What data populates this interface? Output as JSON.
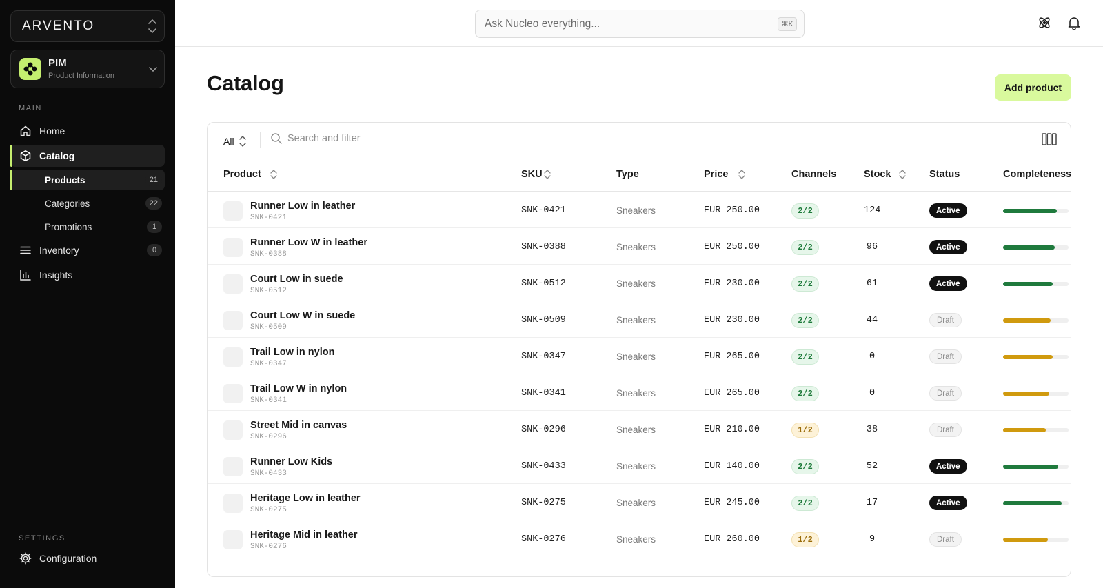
{
  "sidebar": {
    "org_name": "ARVENTO",
    "app": {
      "title": "PIM",
      "subtitle": "Product Information"
    },
    "main_label": "MAIN",
    "settings_label": "SETTINGS",
    "nav": {
      "home": "Home",
      "catalog": "Catalog",
      "inventory": "Inventory",
      "inventory_count": "0",
      "insights": "Insights",
      "configuration": "Configuration"
    },
    "catalog_children": [
      {
        "label": "Products",
        "count": "21"
      },
      {
        "label": "Categories",
        "count": "22"
      },
      {
        "label": "Promotions",
        "count": "1"
      }
    ]
  },
  "topbar": {
    "search_placeholder": "Ask Nucleo everything...",
    "shortcut": "⌘K"
  },
  "page": {
    "title": "Catalog",
    "add_button": "Add product"
  },
  "table": {
    "filter_scope": "All",
    "filter_placeholder": "Search and filter",
    "headers": {
      "product": "Product",
      "sku": "SKU",
      "type": "Type",
      "price": "Price",
      "channels": "Channels",
      "stock": "Stock",
      "status": "Status",
      "completeness": "Completeness"
    },
    "rows": [
      {
        "name": "Runner Low in leather",
        "sku": "SNK-0421",
        "type": "Sneakers",
        "price": "EUR 250.00",
        "channels": "2/2",
        "stock": "124",
        "status": "Active",
        "completeness": 0.82
      },
      {
        "name": "Runner Low W in leather",
        "sku": "SNK-0388",
        "type": "Sneakers",
        "price": "EUR 250.00",
        "channels": "2/2",
        "stock": "96",
        "status": "Active",
        "completeness": 0.79
      },
      {
        "name": "Court Low in suede",
        "sku": "SNK-0512",
        "type": "Sneakers",
        "price": "EUR 230.00",
        "channels": "2/2",
        "stock": "61",
        "status": "Active",
        "completeness": 0.76
      },
      {
        "name": "Court Low W in suede",
        "sku": "SNK-0509",
        "type": "Sneakers",
        "price": "EUR 230.00",
        "channels": "2/2",
        "stock": "44",
        "status": "Draft",
        "completeness": 0.73
      },
      {
        "name": "Trail Low in nylon",
        "sku": "SNK-0347",
        "type": "Sneakers",
        "price": "EUR 265.00",
        "channels": "2/2",
        "stock": "0",
        "status": "Draft",
        "completeness": 0.76
      },
      {
        "name": "Trail Low W in nylon",
        "sku": "SNK-0341",
        "type": "Sneakers",
        "price": "EUR 265.00",
        "channels": "2/2",
        "stock": "0",
        "status": "Draft",
        "completeness": 0.71
      },
      {
        "name": "Street Mid in canvas",
        "sku": "SNK-0296",
        "type": "Sneakers",
        "price": "EUR 210.00",
        "channels": "1/2",
        "stock": "38",
        "status": "Draft",
        "completeness": 0.65
      },
      {
        "name": "Runner Low Kids",
        "sku": "SNK-0433",
        "type": "Sneakers",
        "price": "EUR 140.00",
        "channels": "2/2",
        "stock": "52",
        "status": "Active",
        "completeness": 0.84
      },
      {
        "name": "Heritage Low in leather",
        "sku": "SNK-0275",
        "type": "Sneakers",
        "price": "EUR 245.00",
        "channels": "2/2",
        "stock": "17",
        "status": "Active",
        "completeness": 0.89
      },
      {
        "name": "Heritage Mid in leather",
        "sku": "SNK-0276",
        "type": "Sneakers",
        "price": "EUR 260.00",
        "channels": "1/2",
        "stock": "9",
        "status": "Draft",
        "completeness": 0.68
      }
    ]
  },
  "colors": {
    "accent": "#c5ee6f",
    "button_bg": "#d9f99d",
    "bar_green": "#1f7a3d",
    "bar_amber": "#d09a0e"
  },
  "icons": {
    "org_switch": "chevron-updown-icon",
    "app_switch": "chevron-down-icon",
    "home": "home-icon",
    "catalog": "box-icon",
    "inventory": "list-icon",
    "insights": "bar-chart-icon",
    "configuration": "gear-icon",
    "ai": "atom-icon",
    "notifications": "bell-icon",
    "filter_search": "search-icon",
    "columns": "columns-icon"
  }
}
